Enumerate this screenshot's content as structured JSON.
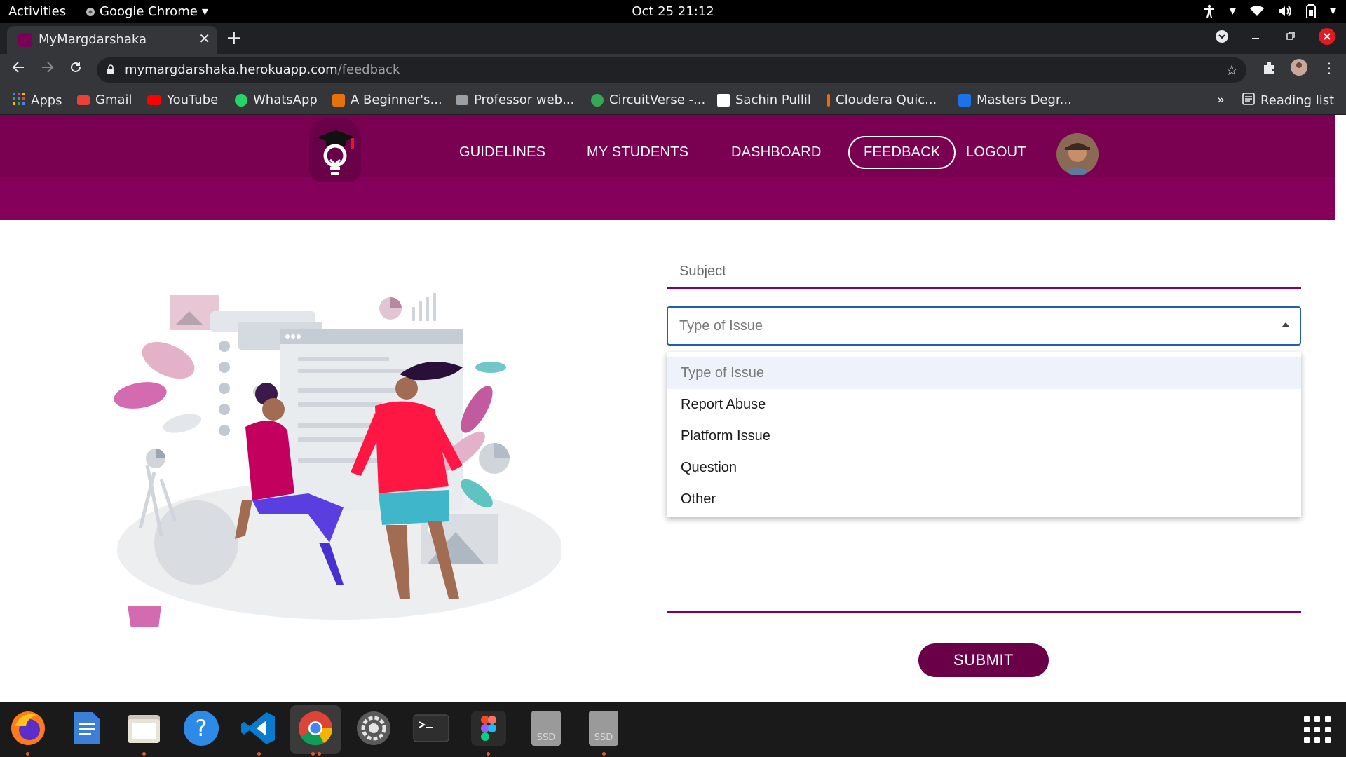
{
  "topbar": {
    "activities": "Activities",
    "app_name": "Google Chrome",
    "clock": "Oct 25  21:12"
  },
  "browser": {
    "tab_title": "MyMargdarshaka",
    "url_host": "mymargdarshaka.herokuapp.com",
    "url_path": "/feedback",
    "bookmarks": [
      {
        "label": "Apps",
        "icon": "apps-grid-icon",
        "color": "#4285f4"
      },
      {
        "label": "Gmail",
        "icon": "gmail-icon",
        "color": "#ea4335"
      },
      {
        "label": "YouTube",
        "icon": "youtube-icon",
        "color": "#ff0000"
      },
      {
        "label": "WhatsApp",
        "icon": "whatsapp-icon",
        "color": "#25d366"
      },
      {
        "label": "A Beginner's...",
        "icon": "site-icon",
        "color": "#e8710a"
      },
      {
        "label": "Professor web...",
        "icon": "folder-icon",
        "color": "#9aa0a6"
      },
      {
        "label": "CircuitVerse -...",
        "icon": "globe-icon",
        "color": "#34a853"
      },
      {
        "label": "Sachin Pullil",
        "icon": "sp-icon",
        "color": "#ffffff"
      },
      {
        "label": "Cloudera Quic...",
        "icon": "cloudera-icon",
        "color": "#f96702"
      },
      {
        "label": "Masters Degr...",
        "icon": "shield-icon",
        "color": "#1a73e8"
      }
    ],
    "more_bookmarks": "»",
    "reading_list": "Reading list"
  },
  "site": {
    "nav": {
      "guidelines": "GUIDELINES",
      "my_students": "MY STUDENTS",
      "dashboard": "DASHBOARD",
      "feedback": "FEEDBACK",
      "logout": "LOGOUT"
    },
    "form": {
      "subject_placeholder": "Subject",
      "issue_select_value": "Type of Issue",
      "issue_options": [
        "Type of Issue",
        "Report Abuse",
        "Platform Issue",
        "Question",
        "Other"
      ],
      "submit": "SUBMIT"
    },
    "colors": {
      "brand": "#85005a",
      "brand_dark": "#6a0048",
      "focus": "#1f5fae"
    }
  },
  "dock": {
    "apps": [
      "firefox-icon",
      "text-editor-icon",
      "files-icon",
      "help-icon",
      "vscode-icon",
      "chrome-icon",
      "settings-icon",
      "terminal-icon",
      "figma-icon",
      "ssd-drive-icon",
      "ssd-drive-icon"
    ],
    "ssd_label": "SSD"
  }
}
